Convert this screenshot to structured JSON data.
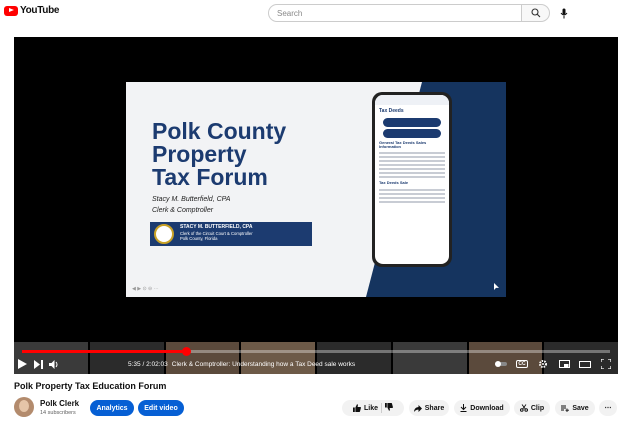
{
  "header": {
    "logo_text": "YouTube",
    "search_placeholder": "Search"
  },
  "slide": {
    "title_lines": [
      "Polk County",
      "Property",
      "Tax Forum"
    ],
    "presenter": "Stacy M. Butterfield, CPA",
    "role": "Clerk & Comptroller",
    "banner_name": "STACY M. BUTTERFIELD, CPA",
    "banner_line1": "Clerk of the Circuit Court & Comptroller",
    "banner_line2": "Polk County, Florida",
    "phone_heading": "Tax Deeds",
    "phone_section": "General Tax Deeds Sales Information",
    "phone_section2": "Tax Deeds Sale"
  },
  "player": {
    "progress_fraction": 0.28,
    "time": "5:35 / 2:02:03",
    "chapter": "Clerk & Comptroller: Understanding how a Tax Deed sale works",
    "cc_label": "CC"
  },
  "video": {
    "title": "Polk Property Tax Education Forum"
  },
  "channel": {
    "name": "Polk Clerk",
    "subscribers": "14 subscribers",
    "analytics_label": "Analytics",
    "edit_label": "Edit video"
  },
  "actions": {
    "like_label": "Like",
    "share_label": "Share",
    "download_label": "Download",
    "clip_label": "Clip",
    "save_label": "Save"
  },
  "colors": {
    "brand_red": "#ff0000",
    "button_blue": "#065fd4",
    "slide_navy": "#1c3b70"
  }
}
